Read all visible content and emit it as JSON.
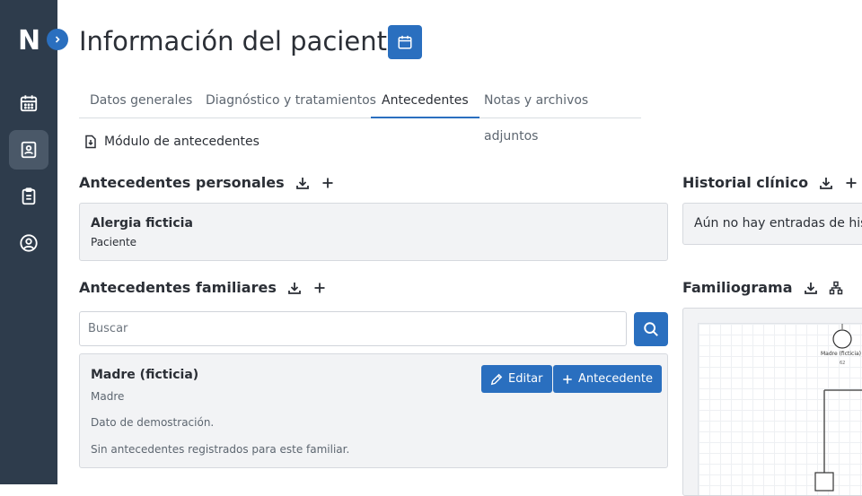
{
  "app": {
    "logo": "N"
  },
  "sidebar": {
    "items": [
      {
        "name": "calendar",
        "icon": "calendar-icon",
        "active": false
      },
      {
        "name": "patients",
        "icon": "contact-card-icon",
        "active": true
      },
      {
        "name": "clipboard",
        "icon": "clipboard-icon",
        "active": false
      },
      {
        "name": "profile",
        "icon": "user-circle-icon",
        "active": false
      }
    ]
  },
  "header": {
    "title": "Información del paciente"
  },
  "tabs": [
    {
      "label": "Datos generales",
      "active": false
    },
    {
      "label": "Diagnóstico y tratamientos",
      "active": false
    },
    {
      "label": "Antecedentes",
      "active": true
    },
    {
      "label": "Notas y archivos adjuntos",
      "active": false
    }
  ],
  "module": {
    "label": "Módulo de antecedentes"
  },
  "personal": {
    "title": "Antecedentes personales",
    "items": [
      {
        "title": "Alergia ficticia",
        "subtitle": "Paciente"
      }
    ]
  },
  "history": {
    "title": "Historial clínico",
    "empty": "Aún no hay entradas de historial"
  },
  "family": {
    "title": "Antecedentes familiares",
    "search_placeholder": "Buscar",
    "members": [
      {
        "name": "Madre (ficticia)",
        "relation": "Madre",
        "note": "Dato de demostración.",
        "empty": "Sin antecedentes registrados para este familiar.",
        "edit_label": "Editar",
        "add_label": "Antecedente"
      }
    ]
  },
  "familiogram": {
    "title": "Familiograma",
    "node_label": "Madre (ficticia)",
    "node_age": "62"
  },
  "colors": {
    "accent": "#2a6fbf",
    "sidebar": "#2e3c4c",
    "card": "#f2f3f5"
  }
}
